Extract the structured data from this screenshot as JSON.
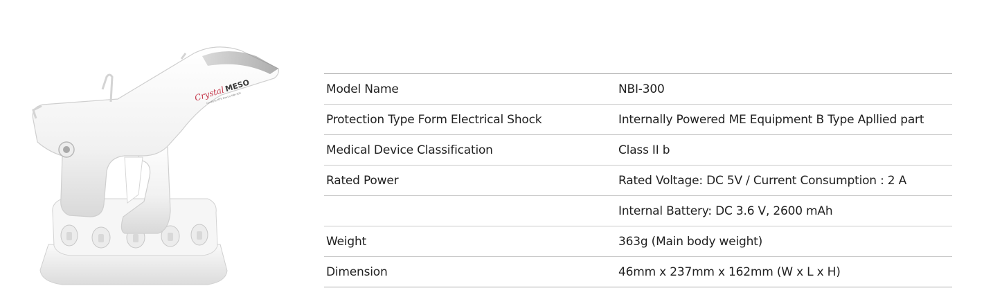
{
  "product": {
    "logo_script": "Crystal",
    "logo_word": "MESO",
    "logo_tagline": "Cordless MTS Device NBI-300"
  },
  "specs": {
    "rows": [
      {
        "label": "Model Name",
        "value": "NBI-300"
      },
      {
        "label": "Protection Type Form Electrical Shock",
        "value": "Internally Powered ME Equipment B Type Apllied part"
      },
      {
        "label": "Medical Device Classification",
        "value": "Class II b"
      },
      {
        "label": "Rated Power",
        "value": "Rated Voltage: DC 5V / Current Consumption : 2 A"
      },
      {
        "label": "",
        "value": "Internal Battery: DC 3.6 V, 2600 mAh"
      },
      {
        "label": "Weight",
        "value": "363g (Main body weight)"
      },
      {
        "label": "Dimension",
        "value": "46mm x 237mm x 162mm (W x L x H)"
      }
    ]
  }
}
